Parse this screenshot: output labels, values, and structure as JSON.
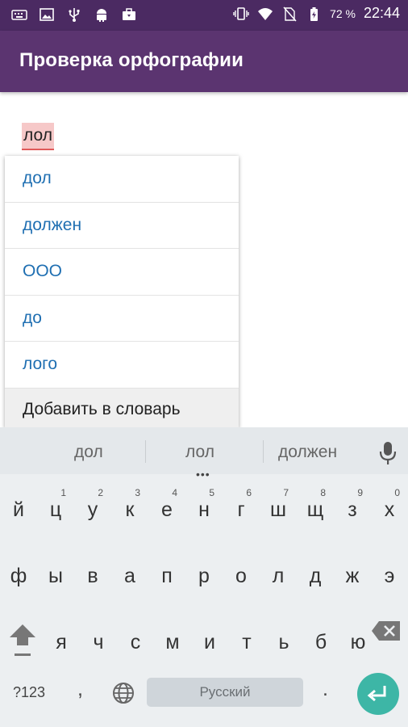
{
  "status_bar": {
    "icons_left": [
      "keyboard-icon",
      "image-icon",
      "usb-icon",
      "android-icon",
      "briefcase-icon"
    ],
    "icons_right": [
      "vibrate-icon",
      "wifi-icon",
      "no-sim-icon",
      "battery-icon"
    ],
    "battery_percent": "72 %",
    "time": "22:44"
  },
  "app_bar": {
    "title": "Проверка орфографии"
  },
  "content": {
    "typed_word": "лол"
  },
  "suggestion_popup": {
    "items": [
      "дол",
      "должен",
      "ООО",
      "до",
      "лого"
    ],
    "add_to_dictionary": "Добавить в словарь"
  },
  "keyboard": {
    "suggestions": [
      "дол",
      "лол",
      "должен"
    ],
    "dots": "•••",
    "row1": [
      {
        "k": "й",
        "h": ""
      },
      {
        "k": "ц",
        "h": "1"
      },
      {
        "k": "у",
        "h": "2"
      },
      {
        "k": "к",
        "h": "3"
      },
      {
        "k": "е",
        "h": "4"
      },
      {
        "k": "н",
        "h": "5"
      },
      {
        "k": "г",
        "h": "6"
      },
      {
        "k": "ш",
        "h": "7"
      },
      {
        "k": "щ",
        "h": "8"
      },
      {
        "k": "з",
        "h": "9"
      },
      {
        "k": "х",
        "h": "0"
      }
    ],
    "row2": [
      "ф",
      "ы",
      "в",
      "а",
      "п",
      "р",
      "о",
      "л",
      "д",
      "ж",
      "э"
    ],
    "row3": [
      "я",
      "ч",
      "с",
      "м",
      "и",
      "т",
      "ь",
      "б",
      "ю"
    ],
    "symbols_label": "?123",
    "comma": ",",
    "space_label": "Русский",
    "period": ".",
    "accent_color": "#3db6a6"
  }
}
